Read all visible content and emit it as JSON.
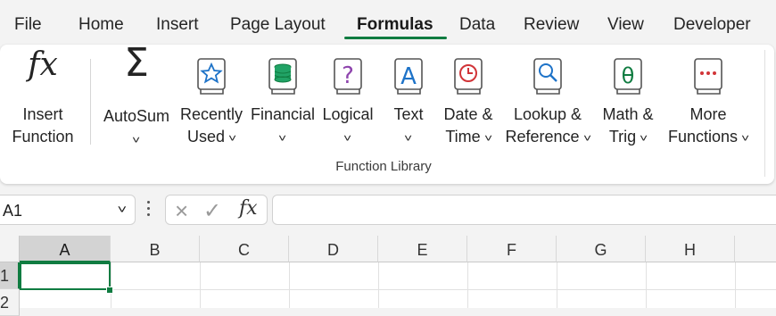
{
  "tabs": [
    "File",
    "Home",
    "Insert",
    "Page Layout",
    "Formulas",
    "Data",
    "Review",
    "View",
    "Developer"
  ],
  "active_tab": "Formulas",
  "ribbon": {
    "insert_function": {
      "line1": "Insert",
      "line2": "Function"
    },
    "autosum": {
      "line1": "AutoSum"
    },
    "recently_used": {
      "line1": "Recently",
      "line2": "Used"
    },
    "financial": {
      "line1": "Financial"
    },
    "logical": {
      "line1": "Logical"
    },
    "text": {
      "line1": "Text"
    },
    "date_time": {
      "line1": "Date &",
      "line2": "Time"
    },
    "lookup_reference": {
      "line1": "Lookup &",
      "line2": "Reference"
    },
    "math_trig": {
      "line1": "Math &",
      "line2": "Trig"
    },
    "more_functions": {
      "line1": "More",
      "line2": "Functions"
    },
    "group_label": "Function Library"
  },
  "formula_bar": {
    "name_box": "A1",
    "fx_label": "fx",
    "formula": ""
  },
  "grid": {
    "columns": [
      "A",
      "B",
      "C",
      "D",
      "E",
      "F",
      "G",
      "H"
    ],
    "rows": [
      "1",
      "2"
    ],
    "active_cell": "A1"
  },
  "colors": {
    "accent": "#107c41",
    "ribbon_bg": "#ffffff",
    "app_bg": "#f3f3f3"
  }
}
